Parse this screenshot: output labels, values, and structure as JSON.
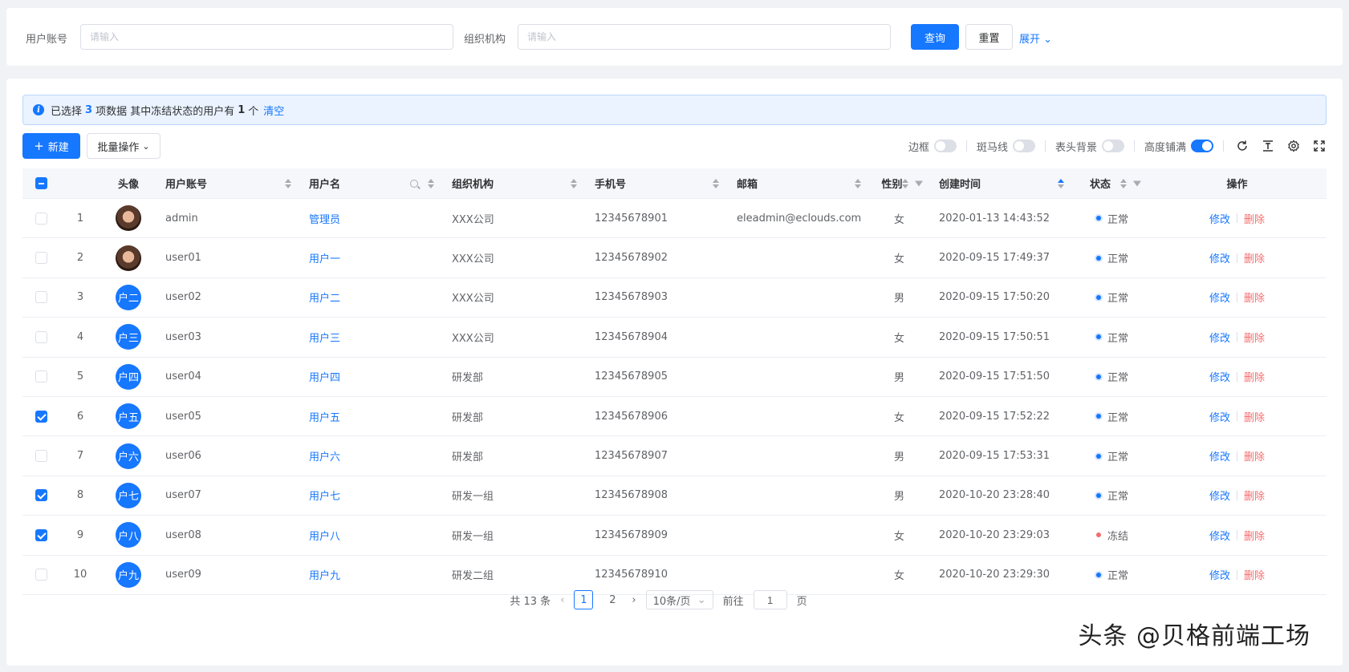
{
  "search": {
    "account_label": "用户账号",
    "account_placeholder": "请输入",
    "org_label": "组织机构",
    "org_placeholder": "请输入",
    "query_btn": "查询",
    "reset_btn": "重置",
    "expand_link": "展开"
  },
  "alert": {
    "prefix": "已选择",
    "selected_count": "3",
    "mid": "项数据 其中冻结状态的用户有",
    "frozen_count": "1",
    "suffix": "个",
    "clear": "清空"
  },
  "toolbar": {
    "new_btn": "新建",
    "batch_btn": "批量操作",
    "border_label": "边框",
    "stripe_label": "斑马线",
    "header_bg_label": "表头背景",
    "height_fill_label": "高度铺满",
    "switches": {
      "border": false,
      "stripe": false,
      "header_bg": false,
      "height_fill": true
    }
  },
  "columns": {
    "avatar": "头像",
    "account": "用户账号",
    "username": "用户名",
    "org": "组织机构",
    "phone": "手机号",
    "email": "邮箱",
    "sex": "性别",
    "created": "创建时间",
    "status": "状态",
    "ops": "操作"
  },
  "ops": {
    "edit": "修改",
    "delete": "删除"
  },
  "rows": [
    {
      "idx": "1",
      "checked": false,
      "avatar_type": "photo",
      "avatar_text": "",
      "account": "admin",
      "name": "管理员",
      "org": "XXX公司",
      "phone": "12345678901",
      "email": "eleadmin@eclouds.com",
      "sex": "女",
      "created": "2020-01-13 14:43:52",
      "status": "正常",
      "status_color": "#1677ff"
    },
    {
      "idx": "2",
      "checked": false,
      "avatar_type": "photo",
      "avatar_text": "",
      "account": "user01",
      "name": "用户一",
      "org": "XXX公司",
      "phone": "12345678902",
      "email": "",
      "sex": "女",
      "created": "2020-09-15 17:49:37",
      "status": "正常",
      "status_color": "#1677ff"
    },
    {
      "idx": "3",
      "checked": false,
      "avatar_type": "text",
      "avatar_text": "户二",
      "account": "user02",
      "name": "用户二",
      "org": "XXX公司",
      "phone": "12345678903",
      "email": "",
      "sex": "男",
      "created": "2020-09-15 17:50:20",
      "status": "正常",
      "status_color": "#1677ff"
    },
    {
      "idx": "4",
      "checked": false,
      "avatar_type": "text",
      "avatar_text": "户三",
      "account": "user03",
      "name": "用户三",
      "org": "XXX公司",
      "phone": "12345678904",
      "email": "",
      "sex": "女",
      "created": "2020-09-15 17:50:51",
      "status": "正常",
      "status_color": "#1677ff"
    },
    {
      "idx": "5",
      "checked": false,
      "avatar_type": "text",
      "avatar_text": "户四",
      "account": "user04",
      "name": "用户四",
      "org": "研发部",
      "phone": "12345678905",
      "email": "",
      "sex": "男",
      "created": "2020-09-15 17:51:50",
      "status": "正常",
      "status_color": "#1677ff"
    },
    {
      "idx": "6",
      "checked": true,
      "avatar_type": "text",
      "avatar_text": "户五",
      "account": "user05",
      "name": "用户五",
      "org": "研发部",
      "phone": "12345678906",
      "email": "",
      "sex": "女",
      "created": "2020-09-15 17:52:22",
      "status": "正常",
      "status_color": "#1677ff"
    },
    {
      "idx": "7",
      "checked": false,
      "avatar_type": "text",
      "avatar_text": "户六",
      "account": "user06",
      "name": "用户六",
      "org": "研发部",
      "phone": "12345678907",
      "email": "",
      "sex": "男",
      "created": "2020-09-15 17:53:31",
      "status": "正常",
      "status_color": "#1677ff"
    },
    {
      "idx": "8",
      "checked": true,
      "avatar_type": "text",
      "avatar_text": "户七",
      "account": "user07",
      "name": "用户七",
      "org": "研发一组",
      "phone": "12345678908",
      "email": "",
      "sex": "男",
      "created": "2020-10-20 23:28:40",
      "status": "正常",
      "status_color": "#1677ff"
    },
    {
      "idx": "9",
      "checked": true,
      "avatar_type": "text",
      "avatar_text": "户八",
      "account": "user08",
      "name": "用户八",
      "org": "研发一组",
      "phone": "12345678909",
      "email": "",
      "sex": "女",
      "created": "2020-10-20 23:29:03",
      "status": "冻结",
      "status_color": "#f56c6c"
    },
    {
      "idx": "10",
      "checked": false,
      "avatar_type": "text",
      "avatar_text": "户九",
      "account": "user09",
      "name": "用户九",
      "org": "研发二组",
      "phone": "12345678910",
      "email": "",
      "sex": "女",
      "created": "2020-10-20 23:29:30",
      "status": "正常",
      "status_color": "#1677ff"
    }
  ],
  "pagination": {
    "total": "共 13 条",
    "pages": [
      "1",
      "2"
    ],
    "current": "1",
    "page_size": "10条/页",
    "goto_label": "前往",
    "goto_value": "1",
    "page_unit": "页"
  },
  "watermark": "头条 @贝格前端工场"
}
